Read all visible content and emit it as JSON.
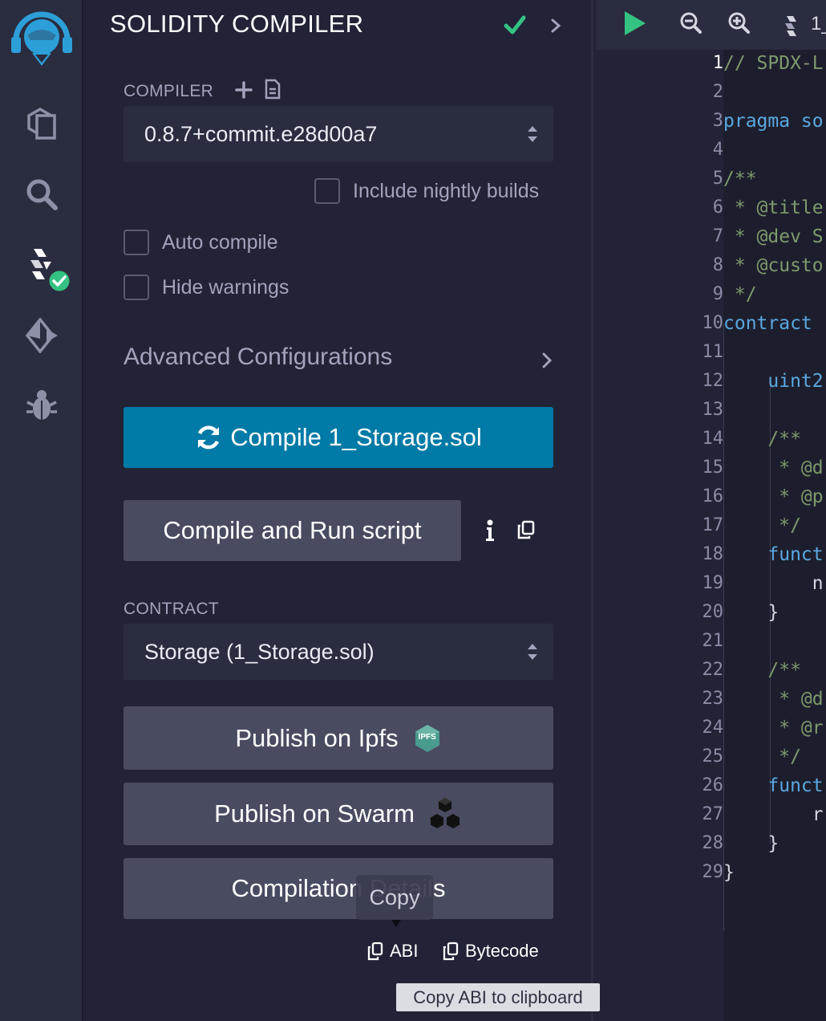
{
  "panel": {
    "title": "SOLIDITY COMPILER",
    "compiler_label": "COMPILER",
    "compiler_version": "0.8.7+commit.e28d00a7",
    "include_nightly_label": "Include nightly builds",
    "auto_compile_label": "Auto compile",
    "hide_warnings_label": "Hide warnings",
    "advanced_label": "Advanced Configurations",
    "compile_button": "Compile 1_Storage.sol",
    "compile_run_button": "Compile and Run script",
    "contract_label": "CONTRACT",
    "contract_selected": "Storage (1_Storage.sol)",
    "publish_ipfs": "Publish on Ipfs",
    "ipfs_badge": "IPFS",
    "publish_swarm": "Publish on Swarm",
    "compilation_details": "Compilation Details",
    "abi_link": "ABI",
    "bytecode_link": "Bytecode",
    "copy_tooltip": "Copy",
    "clipboard_tooltip": "Copy ABI to clipboard"
  },
  "rail": {
    "icons": [
      "remix-logo-icon",
      "file-explorer-icon",
      "search-icon",
      "solidity-compiler-icon",
      "deploy-run-icon",
      "debugger-icon"
    ]
  },
  "editor": {
    "tab_label": "1_",
    "line_numbers": [
      "1",
      "2",
      "3",
      "4",
      "5",
      "6",
      "7",
      "8",
      "9",
      "10",
      "11",
      "12",
      "13",
      "14",
      "15",
      "16",
      "17",
      "18",
      "19",
      "20",
      "21",
      "22",
      "23",
      "24",
      "25",
      "26",
      "27",
      "28",
      "29"
    ],
    "code_lines": [
      {
        "text": "// SPDX-L",
        "kind": "comment"
      },
      {
        "text": "",
        "kind": "plain"
      },
      {
        "text": "pragma so",
        "kind": "kw"
      },
      {
        "text": "",
        "kind": "plain"
      },
      {
        "text": "/**",
        "kind": "comment"
      },
      {
        "text": " * @title",
        "kind": "comment"
      },
      {
        "text": " * @dev S",
        "kind": "comment"
      },
      {
        "text": " * @custo",
        "kind": "comment"
      },
      {
        "text": " */",
        "kind": "comment"
      },
      {
        "text": "contract ",
        "kind": "kw"
      },
      {
        "text": "",
        "kind": "plain"
      },
      {
        "text": "    uint2",
        "kind": "kw"
      },
      {
        "text": "",
        "kind": "plain"
      },
      {
        "text": "    /**",
        "kind": "comment"
      },
      {
        "text": "     * @d",
        "kind": "comment"
      },
      {
        "text": "     * @p",
        "kind": "comment"
      },
      {
        "text": "     */",
        "kind": "comment"
      },
      {
        "text": "    funct",
        "kind": "kw"
      },
      {
        "text": "        n",
        "kind": "plain"
      },
      {
        "text": "    }",
        "kind": "plain"
      },
      {
        "text": "",
        "kind": "plain"
      },
      {
        "text": "    /**",
        "kind": "comment"
      },
      {
        "text": "     * @d",
        "kind": "comment"
      },
      {
        "text": "     * @r",
        "kind": "comment"
      },
      {
        "text": "     */",
        "kind": "comment"
      },
      {
        "text": "    funct",
        "kind": "kw"
      },
      {
        "text": "        r",
        "kind": "plain"
      },
      {
        "text": "    }",
        "kind": "plain"
      },
      {
        "text": "}",
        "kind": "plain"
      }
    ]
  },
  "colors": {
    "accent": "#007aa6",
    "success": "#34c282",
    "ipfs_teal": "#4a9a8e"
  }
}
